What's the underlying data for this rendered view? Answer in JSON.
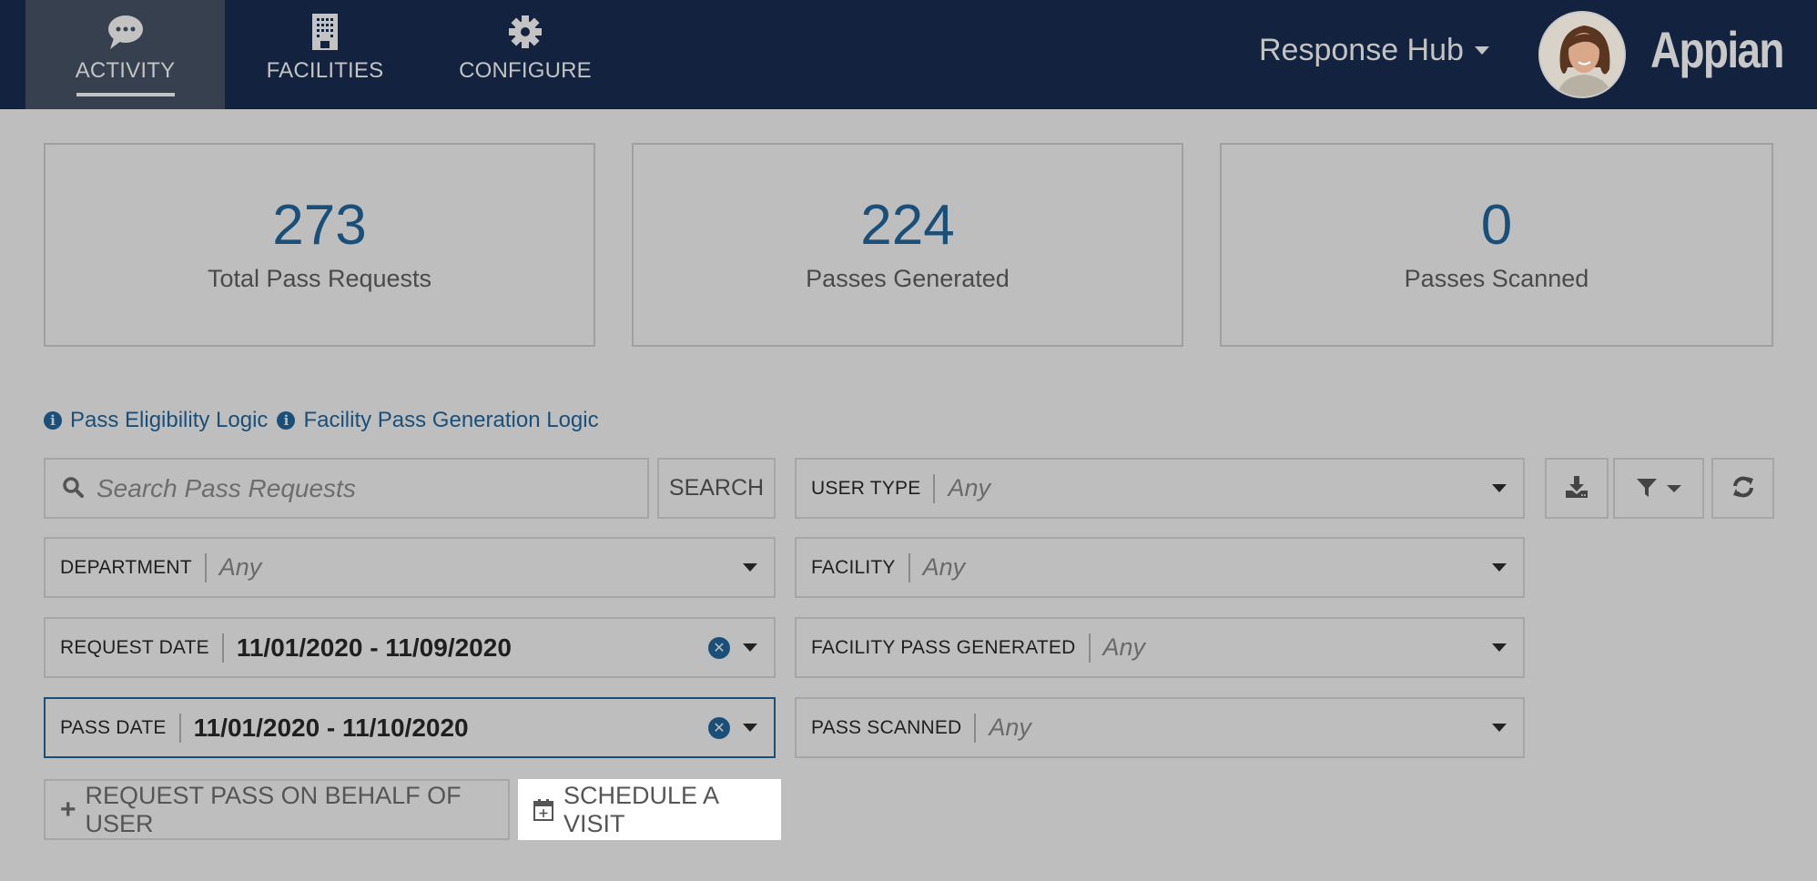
{
  "header": {
    "tabs": [
      {
        "label": "ACTIVITY",
        "icon": "chat-bubble-icon",
        "active": true
      },
      {
        "label": "FACILITIES",
        "icon": "building-icon",
        "active": false
      },
      {
        "label": "CONFIGURE",
        "icon": "gear-icon",
        "active": false
      }
    ],
    "site_name": "Response Hub",
    "logo_text": "Appian"
  },
  "stats": [
    {
      "value": "273",
      "label": "Total Pass Requests"
    },
    {
      "value": "224",
      "label": "Passes Generated"
    },
    {
      "value": "0",
      "label": "Passes Scanned"
    }
  ],
  "links": [
    {
      "label": "Pass Eligibility Logic",
      "icon": "info-icon"
    },
    {
      "label": "Facility Pass Generation Logic",
      "icon": "info-icon"
    }
  ],
  "search": {
    "placeholder": "Search Pass Requests",
    "value": "",
    "button_label": "SEARCH"
  },
  "filters": {
    "user_type": {
      "label": "USER TYPE",
      "value": "Any"
    },
    "department": {
      "label": "DEPARTMENT",
      "value": "Any"
    },
    "facility": {
      "label": "FACILITY",
      "value": "Any"
    },
    "request_date": {
      "label": "REQUEST DATE",
      "value": "11/01/2020 - 11/09/2020"
    },
    "facility_pass_generated": {
      "label": "FACILITY PASS GENERATED",
      "value": "Any"
    },
    "pass_date": {
      "label": "PASS DATE",
      "value": "11/01/2020 - 11/10/2020"
    },
    "pass_scanned": {
      "label": "PASS SCANNED",
      "value": "Any"
    }
  },
  "toolbar": {
    "download_icon": "download-icon",
    "filter_icon": "filter-icon",
    "refresh_icon": "refresh-icon"
  },
  "actions": {
    "request_pass_label": "REQUEST PASS ON BEHALF OF USER",
    "schedule_visit_label": "SCHEDULE A VISIT"
  },
  "colors": {
    "header_bg": "#13233f",
    "accent": "#1a4f7a",
    "page_bg": "#bebebe"
  }
}
